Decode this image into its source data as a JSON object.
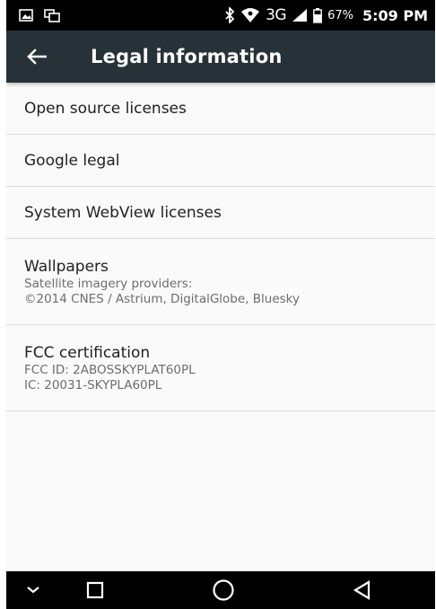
{
  "status_bar": {
    "network": "3G",
    "battery_percent": "67%",
    "time": "5:09 PM",
    "left_icons": [
      "image-icon",
      "cast-screens-icon"
    ],
    "right_icons": [
      "bluetooth-icon",
      "wifi-icon",
      "signal-icon",
      "battery-icon"
    ]
  },
  "toolbar": {
    "title": "Legal information",
    "back_icon": "arrow-left-icon",
    "background": "#263238"
  },
  "items": [
    {
      "title": "Open source licenses"
    },
    {
      "title": "Google legal"
    },
    {
      "title": "System WebView licenses"
    },
    {
      "title": "Wallpapers",
      "lines": [
        "Satellite imagery providers:",
        "©2014 CNES / Astrium, DigitalGlobe, Bluesky"
      ]
    },
    {
      "title": "FCC certification",
      "lines": [
        "FCC ID: 2ABOSSKYPLAT60PL",
        "IC: 20031-SKYPLA60PL"
      ]
    }
  ],
  "nav_bar": {
    "buttons": [
      "chevron-down-icon",
      "recents-square-icon",
      "home-circle-icon",
      "back-triangle-icon"
    ]
  }
}
